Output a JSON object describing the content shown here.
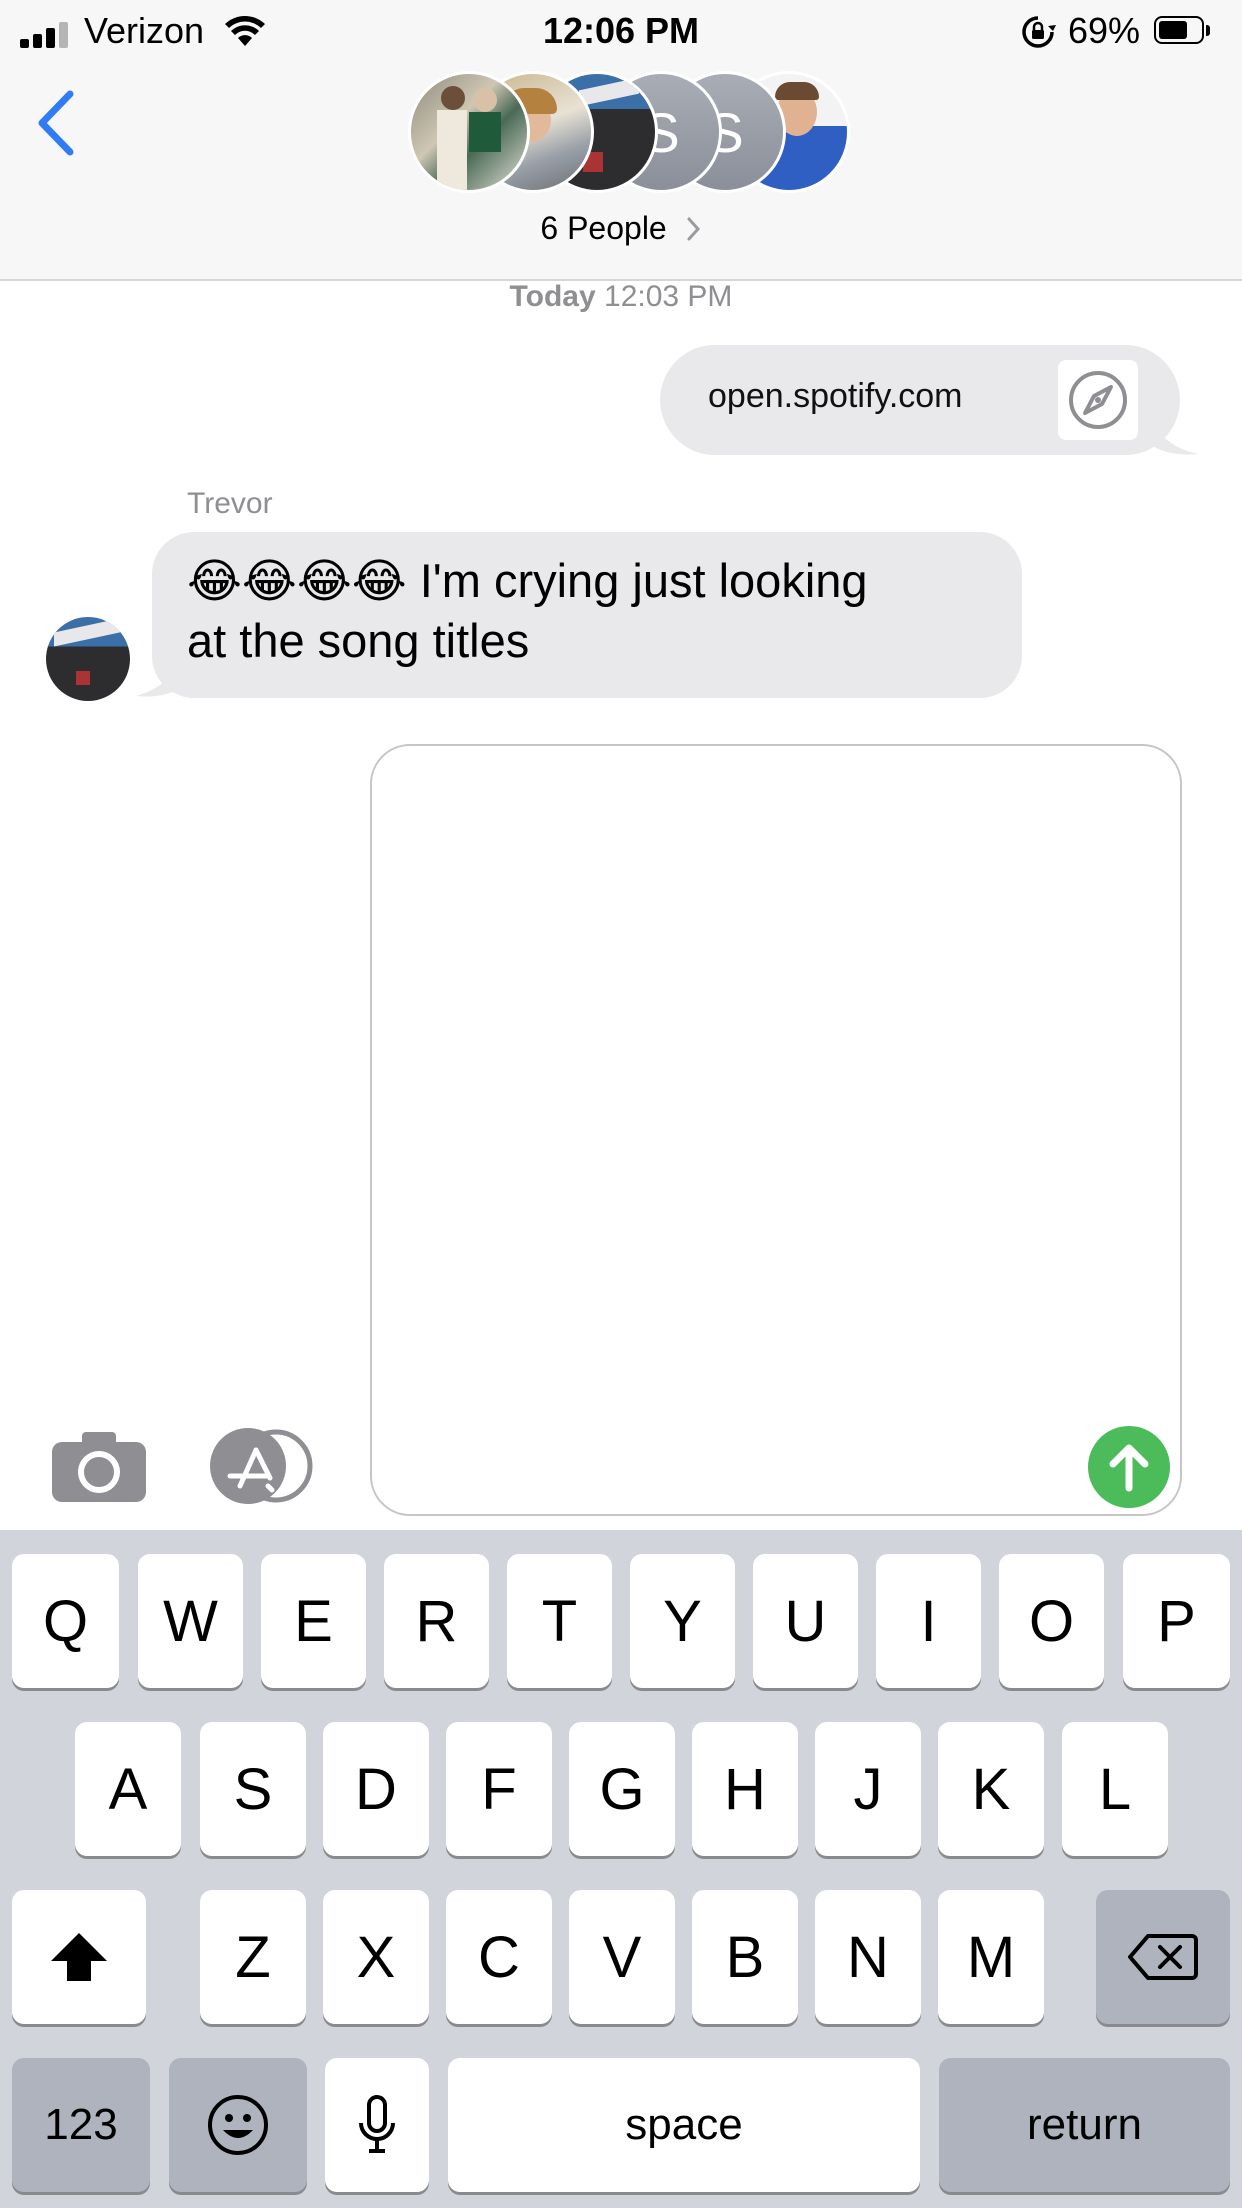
{
  "status_bar": {
    "carrier": "Verizon",
    "time": "12:06 PM",
    "battery": "69%",
    "battery_level": 0.69
  },
  "header": {
    "group_label": "6 People",
    "avatars": [
      {
        "type": "photo",
        "name": "avatar-photo-couple"
      },
      {
        "type": "photo",
        "name": "avatar-photo-woman"
      },
      {
        "type": "photo",
        "name": "avatar-photo-hooters"
      },
      {
        "type": "letter",
        "letter": "S"
      },
      {
        "type": "letter",
        "letter": "S"
      },
      {
        "type": "photo",
        "name": "avatar-photo-man"
      }
    ]
  },
  "conversation": {
    "timestamp_day": "Today",
    "timestamp_time": "12:03 PM",
    "messages": [
      {
        "direction": "outgoing",
        "text": "open.spotify.com",
        "icon": "compass-icon"
      },
      {
        "direction": "incoming",
        "sender": "Trevor",
        "text_line1": "😂😂😂😂 I'm crying just looking",
        "text_line2": "at the song titles"
      }
    ]
  },
  "composer": {
    "camera_icon": "camera-icon",
    "apps_icon": "app-store-icon",
    "send_icon": "send-arrow-icon",
    "input_value": ""
  },
  "keyboard": {
    "row1": [
      "Q",
      "W",
      "E",
      "R",
      "T",
      "Y",
      "U",
      "I",
      "O",
      "P"
    ],
    "row2": [
      "A",
      "S",
      "D",
      "F",
      "G",
      "H",
      "J",
      "K",
      "L"
    ],
    "row3": [
      "Z",
      "X",
      "C",
      "V",
      "B",
      "N",
      "M"
    ],
    "numbers_label": "123",
    "space_label": "space",
    "return_label": "return"
  },
  "colors": {
    "accent_blue": "#2f7cf6",
    "send_green": "#4cbb5a",
    "bubble_gray": "#e9e9eb",
    "keyboard_bg": "#d1d4da"
  }
}
